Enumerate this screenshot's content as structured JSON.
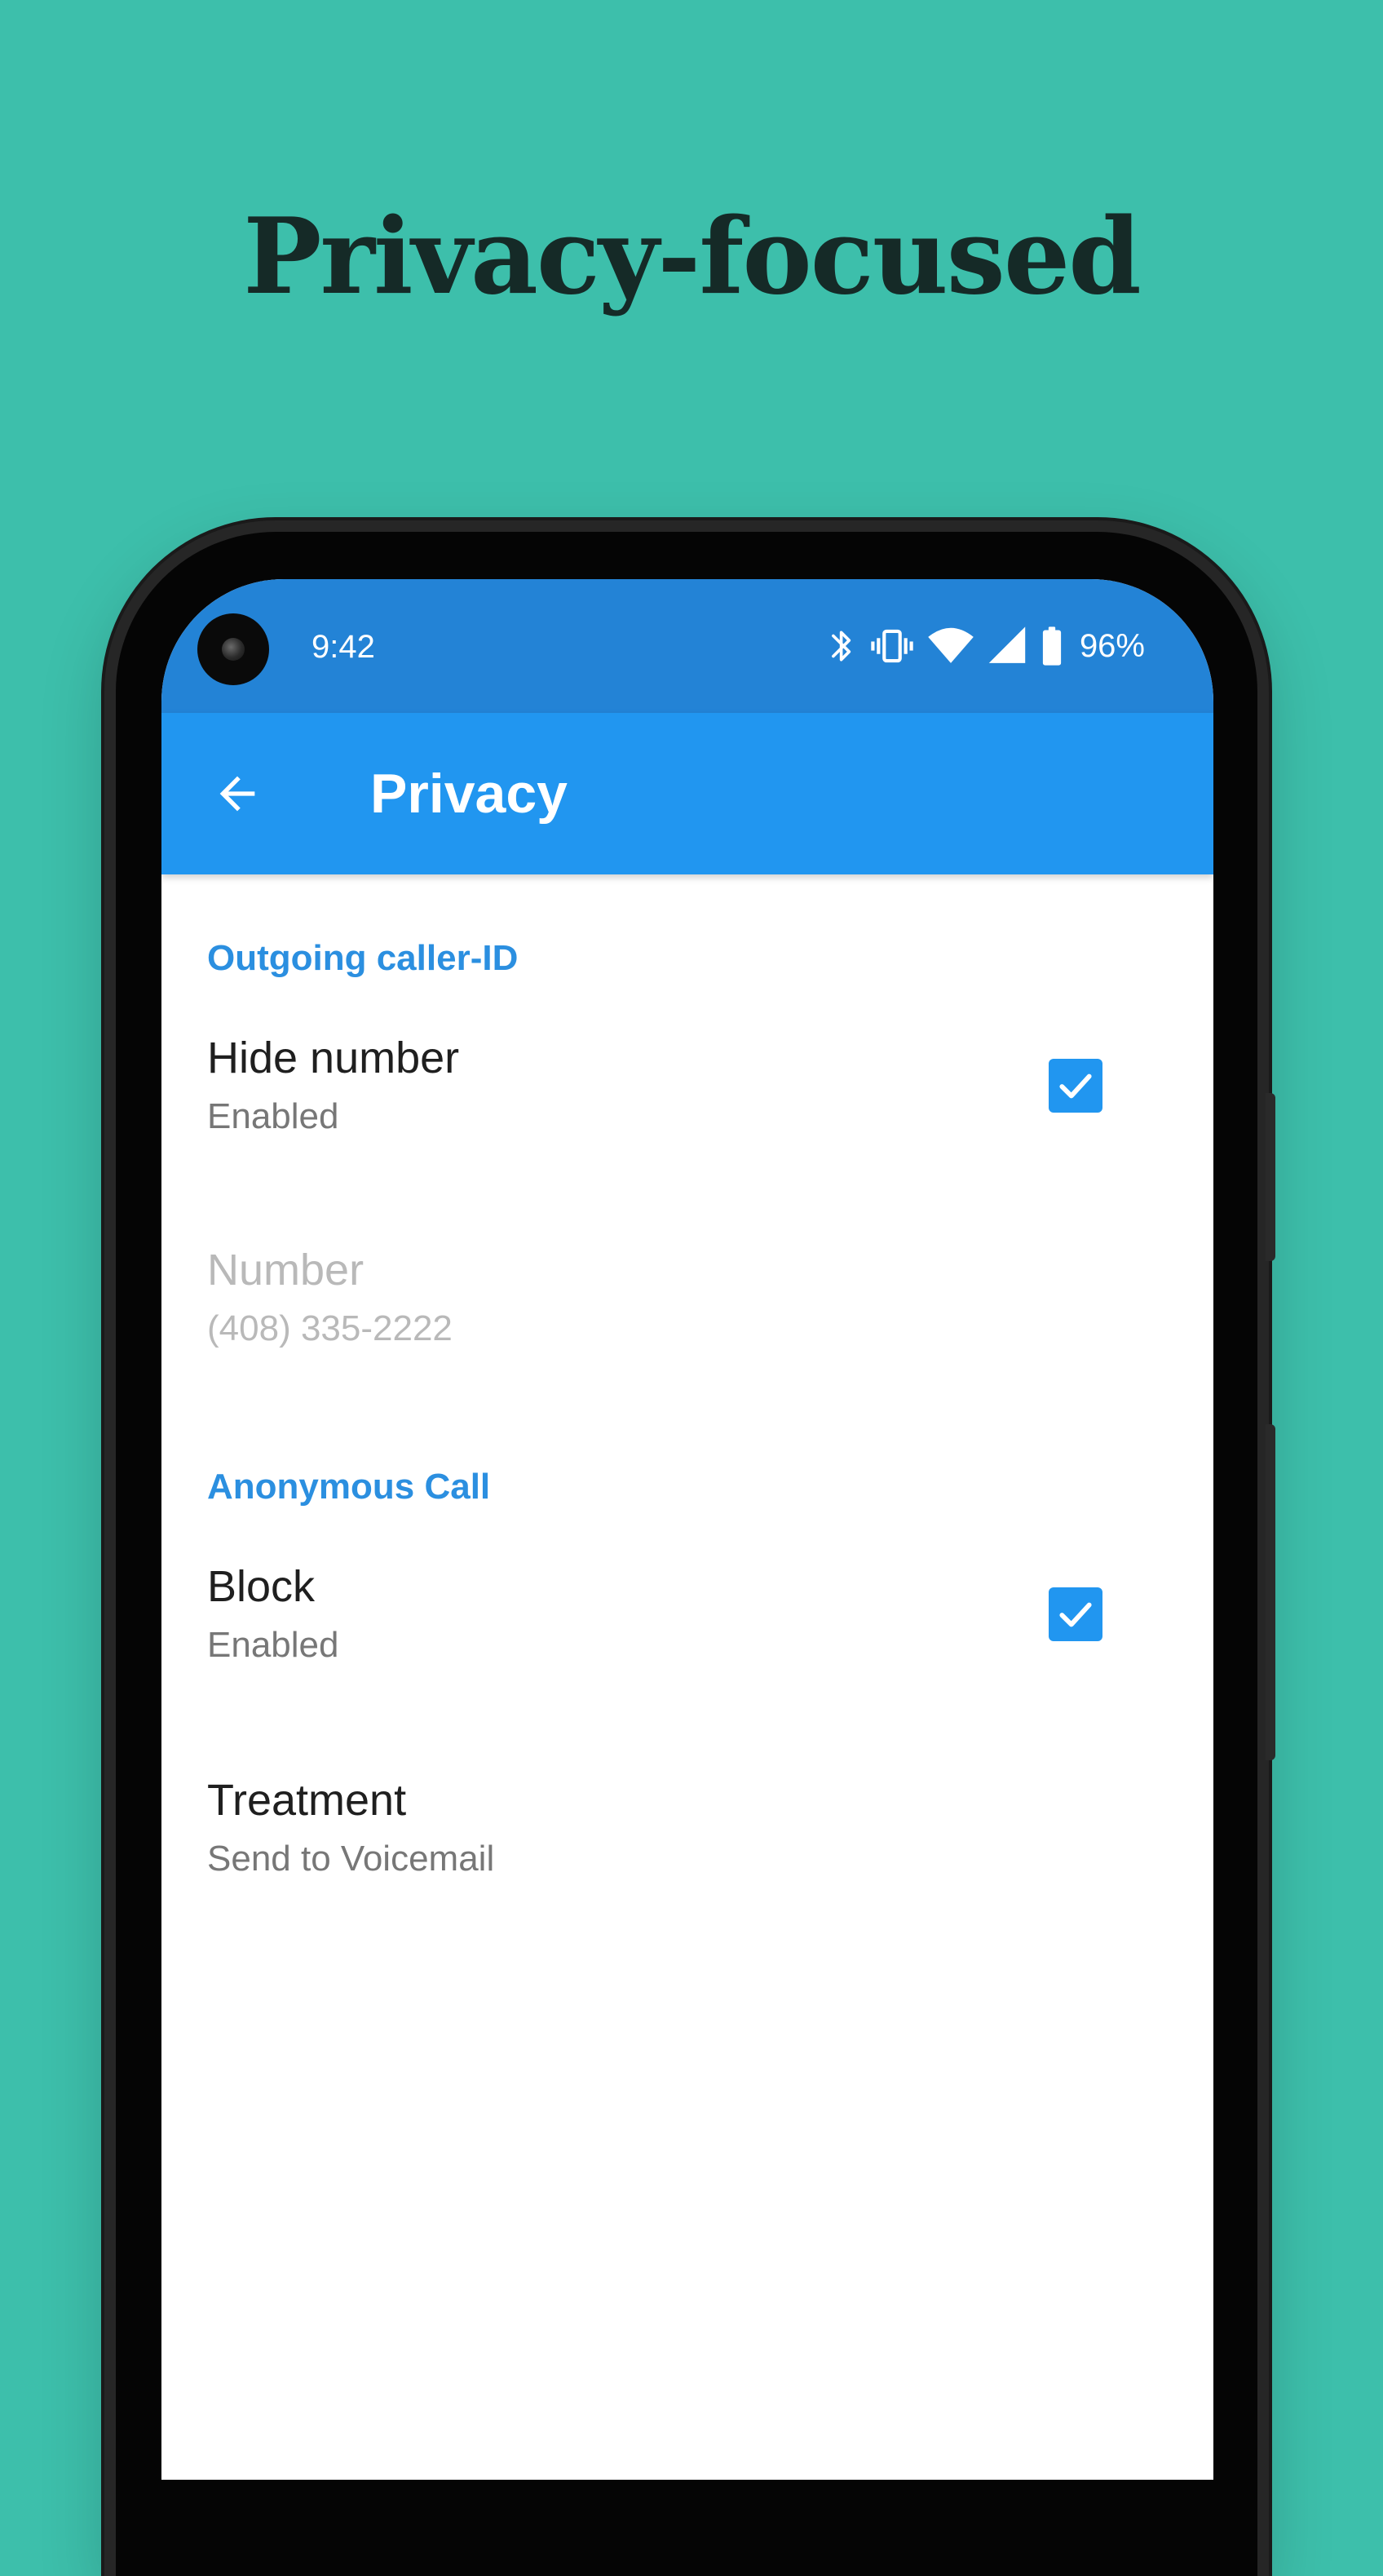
{
  "headline": "Privacy-focused",
  "status_bar": {
    "time": "9:42",
    "battery_percent": "96%",
    "icons": [
      "bluetooth-icon",
      "vibrate-icon",
      "wifi-icon",
      "signal-icon",
      "battery-icon"
    ]
  },
  "app_bar": {
    "title": "Privacy",
    "back_icon": "arrow-back-icon"
  },
  "sections": [
    {
      "header": "Outgoing caller-ID",
      "items": [
        {
          "title": "Hide number",
          "summary": "Enabled",
          "checked": true
        },
        {
          "title": "Number",
          "summary": "(408) 335-2222",
          "disabled": true
        }
      ]
    },
    {
      "header": "Anonymous Call",
      "items": [
        {
          "title": "Block",
          "summary": "Enabled",
          "checked": true
        },
        {
          "title": "Treatment",
          "summary": "Send to Voicemail"
        }
      ]
    }
  ],
  "colors": {
    "background": "#3dbfab",
    "status_bar": "#2383d6",
    "app_bar": "#2196f0",
    "accent": "#2b8fe0",
    "headline": "#152a27"
  }
}
